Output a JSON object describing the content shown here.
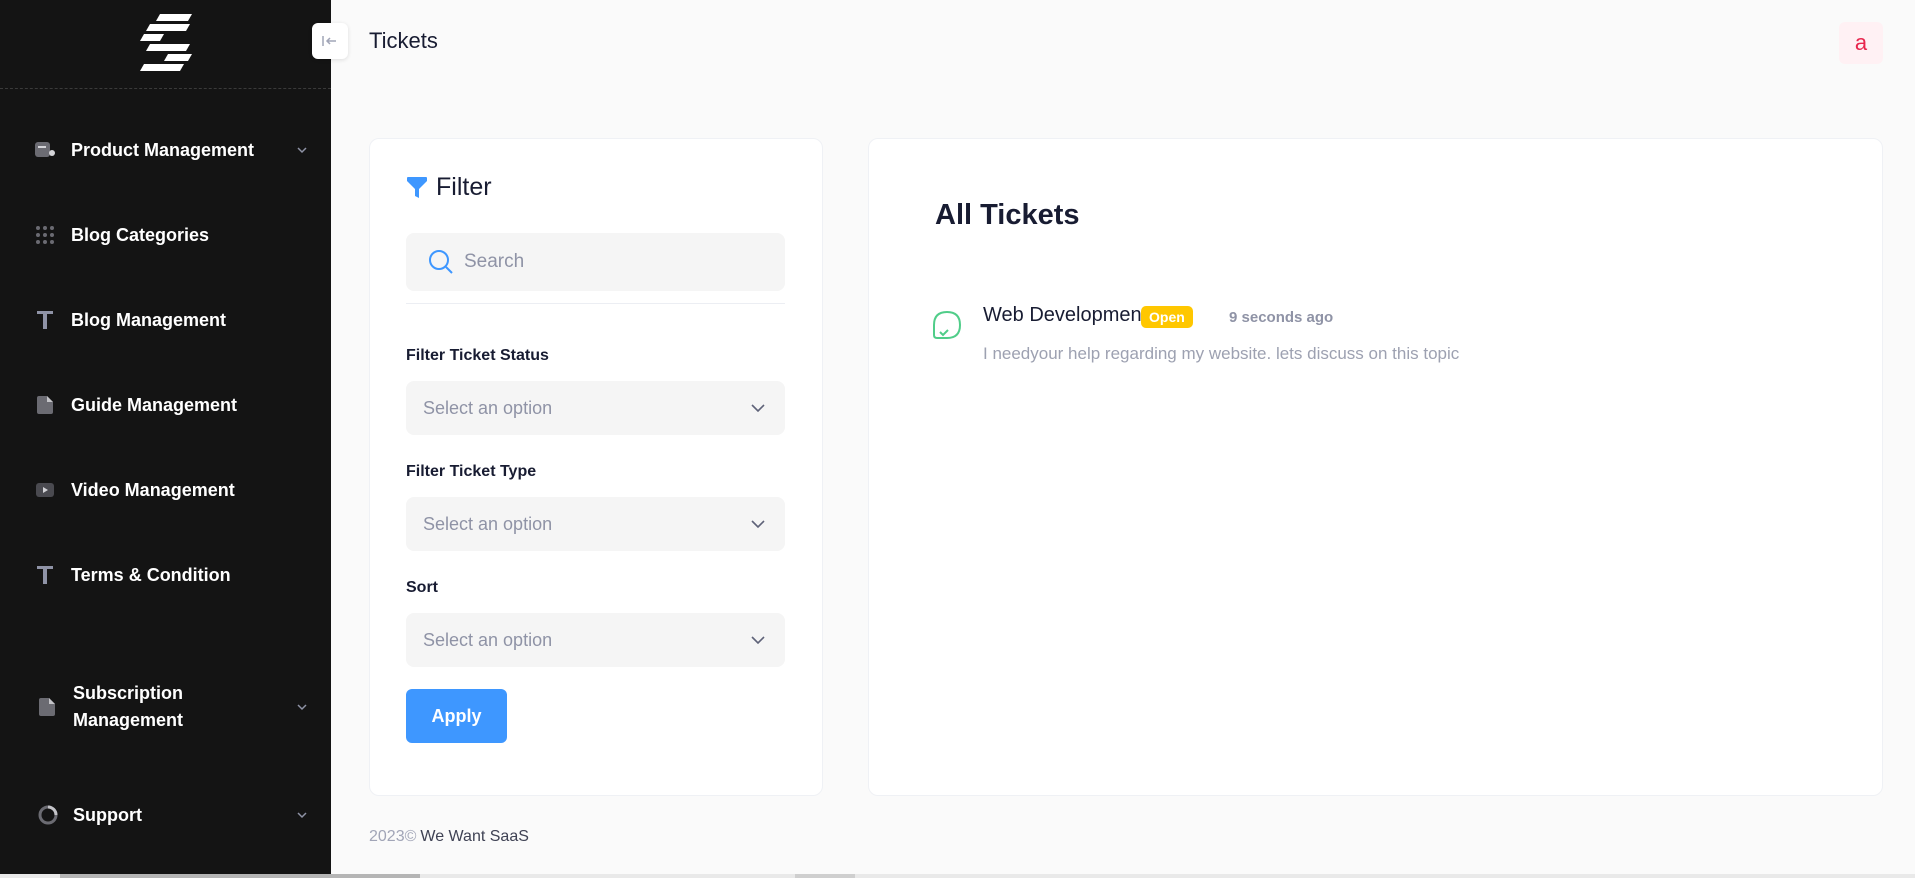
{
  "header": {
    "page_title": "Tickets",
    "avatar_letter": "a"
  },
  "sidebar": {
    "items": [
      {
        "label": "Product Management",
        "icon": "product-icon",
        "has_chevron": true
      },
      {
        "label": "Blog Categories",
        "icon": "grid-dots-icon",
        "has_chevron": false
      },
      {
        "label": "Blog Management",
        "icon": "text-icon",
        "has_chevron": false
      },
      {
        "label": "Guide Management",
        "icon": "document-icon",
        "has_chevron": false
      },
      {
        "label": "Video Management",
        "icon": "video-icon",
        "has_chevron": false
      },
      {
        "label": "Terms & Condition",
        "icon": "text-icon",
        "has_chevron": false
      },
      {
        "label": "Subscription Management",
        "icon": "document-icon",
        "has_chevron": true
      },
      {
        "label": "Support",
        "icon": "support-icon",
        "has_chevron": true
      }
    ]
  },
  "filter": {
    "title": "Filter",
    "search_placeholder": "Search",
    "status_label": "Filter Ticket Status",
    "status_value": "Select an option",
    "type_label": "Filter Ticket Type",
    "type_value": "Select an option",
    "sort_label": "Sort",
    "sort_value": "Select an option",
    "apply_label": "Apply"
  },
  "tickets": {
    "title": "All Tickets",
    "items": [
      {
        "title": "Web Development",
        "status": "Open",
        "time": "9 seconds ago",
        "description": "I needyour help regarding my website. lets discuss on this topic"
      }
    ]
  },
  "footer": {
    "year": "2023©",
    "brand": "We Want SaaS"
  },
  "colors": {
    "primary": "#3e97ff",
    "sidebar_bg": "#141414",
    "badge_open": "#ffc700",
    "ticket_icon": "#50cd89",
    "avatar_text": "#e8264d"
  }
}
